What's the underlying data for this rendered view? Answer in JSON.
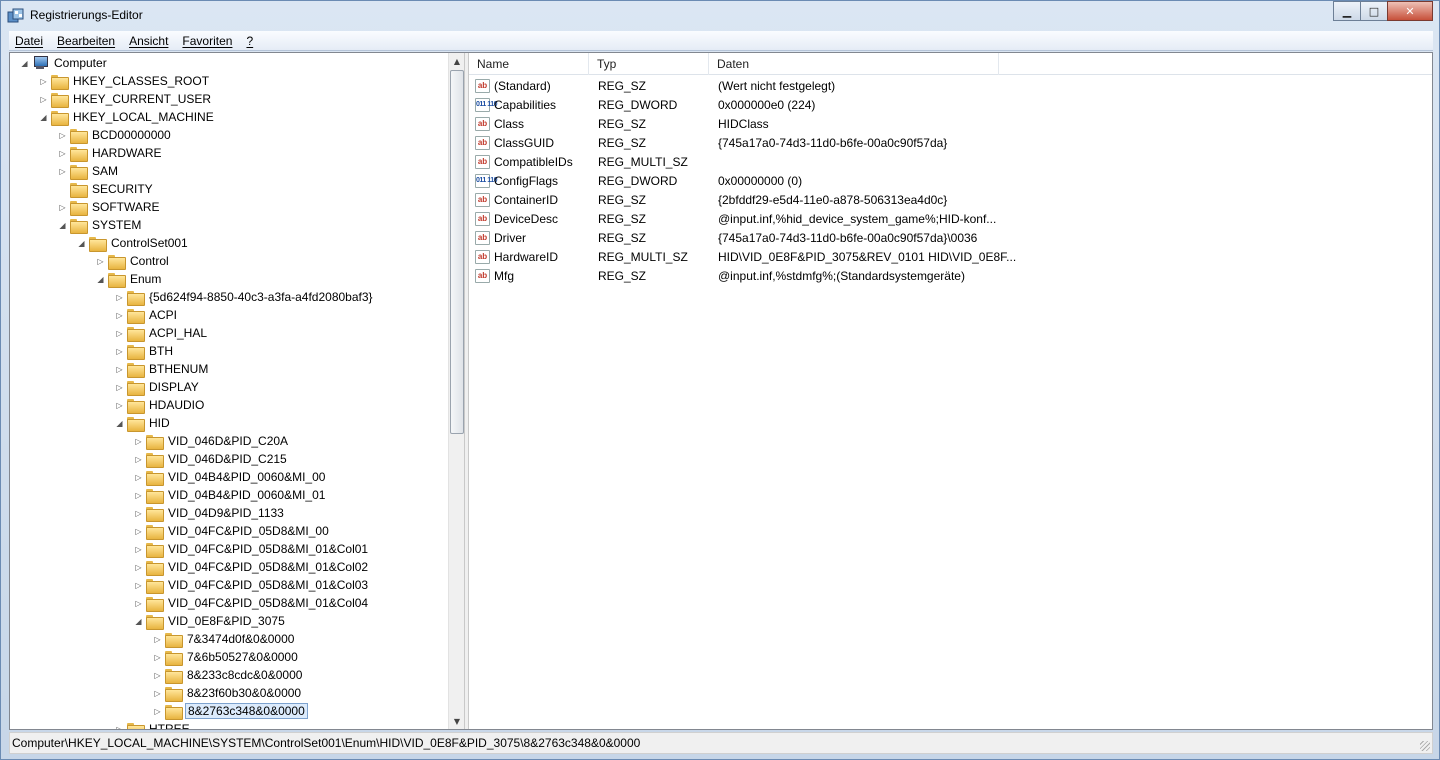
{
  "window": {
    "title": "Registrierungs-Editor",
    "minimize_label": "▁",
    "maximize_label": "□",
    "close_label": "✕"
  },
  "menu": [
    "Datei",
    "Bearbeiten",
    "Ansicht",
    "Favoriten",
    "?"
  ],
  "tree": [
    {
      "label": "Computer",
      "level": 0,
      "state": "expanded",
      "icon": "computer-icon"
    },
    {
      "label": "HKEY_CLASSES_ROOT",
      "level": 1,
      "state": "collapsed",
      "icon": "folder-icon"
    },
    {
      "label": "HKEY_CURRENT_USER",
      "level": 1,
      "state": "collapsed",
      "icon": "folder-icon"
    },
    {
      "label": "HKEY_LOCAL_MACHINE",
      "level": 1,
      "state": "expanded",
      "icon": "folder-icon"
    },
    {
      "label": "BCD00000000",
      "level": 2,
      "state": "collapsed",
      "icon": "folder-icon"
    },
    {
      "label": "HARDWARE",
      "level": 2,
      "state": "collapsed",
      "icon": "folder-icon"
    },
    {
      "label": "SAM",
      "level": 2,
      "state": "collapsed",
      "icon": "folder-icon"
    },
    {
      "label": "SECURITY",
      "level": 2,
      "state": "none",
      "icon": "folder-icon"
    },
    {
      "label": "SOFTWARE",
      "level": 2,
      "state": "collapsed",
      "icon": "folder-icon"
    },
    {
      "label": "SYSTEM",
      "level": 2,
      "state": "expanded",
      "icon": "folder-icon"
    },
    {
      "label": "ControlSet001",
      "level": 3,
      "state": "expanded",
      "icon": "folder-icon"
    },
    {
      "label": "Control",
      "level": 4,
      "state": "collapsed",
      "icon": "folder-icon"
    },
    {
      "label": "Enum",
      "level": 4,
      "state": "expanded",
      "icon": "folder-icon"
    },
    {
      "label": "{5d624f94-8850-40c3-a3fa-a4fd2080baf3}",
      "level": 5,
      "state": "collapsed",
      "icon": "folder-icon"
    },
    {
      "label": "ACPI",
      "level": 5,
      "state": "collapsed",
      "icon": "folder-icon"
    },
    {
      "label": "ACPI_HAL",
      "level": 5,
      "state": "collapsed",
      "icon": "folder-icon"
    },
    {
      "label": "BTH",
      "level": 5,
      "state": "collapsed",
      "icon": "folder-icon"
    },
    {
      "label": "BTHENUM",
      "level": 5,
      "state": "collapsed",
      "icon": "folder-icon"
    },
    {
      "label": "DISPLAY",
      "level": 5,
      "state": "collapsed",
      "icon": "folder-icon"
    },
    {
      "label": "HDAUDIO",
      "level": 5,
      "state": "collapsed",
      "icon": "folder-icon"
    },
    {
      "label": "HID",
      "level": 5,
      "state": "expanded",
      "icon": "folder-icon"
    },
    {
      "label": "VID_046D&PID_C20A",
      "level": 6,
      "state": "collapsed",
      "icon": "folder-icon"
    },
    {
      "label": "VID_046D&PID_C215",
      "level": 6,
      "state": "collapsed",
      "icon": "folder-icon"
    },
    {
      "label": "VID_04B4&PID_0060&MI_00",
      "level": 6,
      "state": "collapsed",
      "icon": "folder-icon"
    },
    {
      "label": "VID_04B4&PID_0060&MI_01",
      "level": 6,
      "state": "collapsed",
      "icon": "folder-icon"
    },
    {
      "label": "VID_04D9&PID_1133",
      "level": 6,
      "state": "collapsed",
      "icon": "folder-icon"
    },
    {
      "label": "VID_04FC&PID_05D8&MI_00",
      "level": 6,
      "state": "collapsed",
      "icon": "folder-icon"
    },
    {
      "label": "VID_04FC&PID_05D8&MI_01&Col01",
      "level": 6,
      "state": "collapsed",
      "icon": "folder-icon"
    },
    {
      "label": "VID_04FC&PID_05D8&MI_01&Col02",
      "level": 6,
      "state": "collapsed",
      "icon": "folder-icon"
    },
    {
      "label": "VID_04FC&PID_05D8&MI_01&Col03",
      "level": 6,
      "state": "collapsed",
      "icon": "folder-icon"
    },
    {
      "label": "VID_04FC&PID_05D8&MI_01&Col04",
      "level": 6,
      "state": "collapsed",
      "icon": "folder-icon"
    },
    {
      "label": "VID_0E8F&PID_3075",
      "level": 6,
      "state": "expanded",
      "icon": "folder-icon"
    },
    {
      "label": "7&3474d0f&0&0000",
      "level": 7,
      "state": "collapsed",
      "icon": "folder-icon"
    },
    {
      "label": "7&6b50527&0&0000",
      "level": 7,
      "state": "collapsed",
      "icon": "folder-icon"
    },
    {
      "label": "8&233c8cdc&0&0000",
      "level": 7,
      "state": "collapsed",
      "icon": "folder-icon"
    },
    {
      "label": "8&23f60b30&0&0000",
      "level": 7,
      "state": "collapsed",
      "icon": "folder-icon"
    },
    {
      "label": "8&2763c348&0&0000",
      "level": 7,
      "state": "collapsed",
      "icon": "folder-icon",
      "selected": true
    },
    {
      "label": "HTREE",
      "level": 5,
      "state": "collapsed",
      "icon": "folder-icon"
    }
  ],
  "list": {
    "columns": [
      "Name",
      "Typ",
      "Daten"
    ],
    "rows": [
      {
        "name": "(Standard)",
        "type": "REG_SZ",
        "data": "(Wert nicht festgelegt)",
        "icon": "ab"
      },
      {
        "name": "Capabilities",
        "type": "REG_DWORD",
        "data": "0x000000e0 (224)",
        "icon": "dword"
      },
      {
        "name": "Class",
        "type": "REG_SZ",
        "data": "HIDClass",
        "icon": "ab"
      },
      {
        "name": "ClassGUID",
        "type": "REG_SZ",
        "data": "{745a17a0-74d3-11d0-b6fe-00a0c90f57da}",
        "icon": "ab"
      },
      {
        "name": "CompatibleIDs",
        "type": "REG_MULTI_SZ",
        "data": "",
        "icon": "ab"
      },
      {
        "name": "ConfigFlags",
        "type": "REG_DWORD",
        "data": "0x00000000 (0)",
        "icon": "dword"
      },
      {
        "name": "ContainerID",
        "type": "REG_SZ",
        "data": "{2bfddf29-e5d4-11e0-a878-506313ea4d0c}",
        "icon": "ab"
      },
      {
        "name": "DeviceDesc",
        "type": "REG_SZ",
        "data": "@input.inf,%hid_device_system_game%;HID-konf...",
        "icon": "ab"
      },
      {
        "name": "Driver",
        "type": "REG_SZ",
        "data": "{745a17a0-74d3-11d0-b6fe-00a0c90f57da}\\0036",
        "icon": "ab"
      },
      {
        "name": "HardwareID",
        "type": "REG_MULTI_SZ",
        "data": "HID\\VID_0E8F&PID_3075&REV_0101 HID\\VID_0E8F...",
        "icon": "ab"
      },
      {
        "name": "Mfg",
        "type": "REG_SZ",
        "data": "@input.inf,%stdmfg%;(Standardsystemgeräte)",
        "icon": "ab"
      }
    ]
  },
  "statusbar": {
    "path": "Computer\\HKEY_LOCAL_MACHINE\\SYSTEM\\ControlSet001\\Enum\\HID\\VID_0E8F&PID_3075\\8&2763c348&0&0000"
  },
  "icons": {
    "string_value": "ab",
    "dword_value": "011 110"
  },
  "colors": {
    "selection_border": "#7da2ce",
    "selection_fill": "#dcebfc",
    "folder": "#e8b440"
  }
}
